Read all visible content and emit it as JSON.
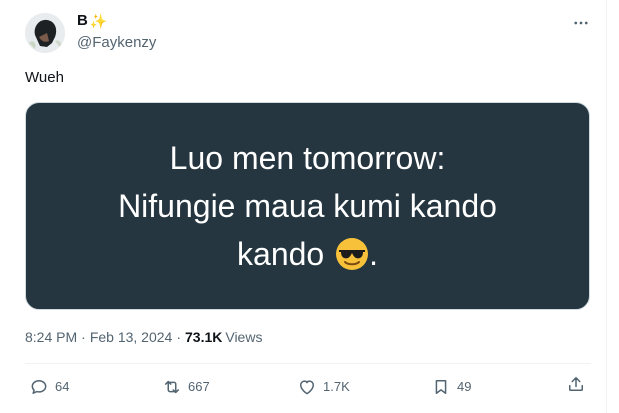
{
  "tweet": {
    "display_name": "B",
    "display_name_emoji": "✨",
    "handle": "@Faykenzy",
    "more_icon": "more-dots-icon",
    "text": "Wueh",
    "media": {
      "lines": [
        "Luo men tomorrow:",
        "Nifungie maua kumi kando",
        "kando"
      ],
      "trailing_punct": "."
    },
    "time": "8:24 PM",
    "sep1": "·",
    "date": "Feb 13, 2024",
    "sep2": "·",
    "views_count": "73.1K",
    "views_label": "Views",
    "actions": {
      "replies": "64",
      "reposts": "667",
      "likes": "1.7K",
      "bookmarks": "49"
    }
  },
  "colors": {
    "text": "#0f1419",
    "secondary": "#536471",
    "media_bg": "#253640",
    "divider": "#eff3f4"
  }
}
